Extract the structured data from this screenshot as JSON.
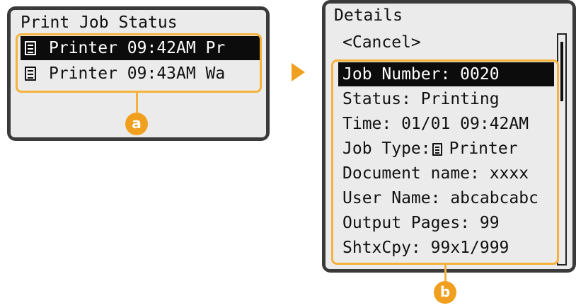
{
  "left_screen": {
    "title": "Print Job Status",
    "jobs": [
      {
        "icon": "document-icon",
        "text": "Printer 09:42AM Pr"
      },
      {
        "icon": "document-icon",
        "text": "Printer 09:43AM Wa"
      }
    ]
  },
  "right_screen": {
    "title": "Details",
    "cancel": "<Cancel>",
    "items": [
      "Job Number: 0020",
      "Status: Printing",
      "Time: 01/01 09:42AM",
      "Document name: xxxx",
      "User Name: abcabcabc",
      "Output Pages: 99",
      "ShtxCpy: 99x1/999"
    ],
    "job_type": {
      "label": "Job Type:",
      "icon": "document-icon",
      "value": "Printer"
    }
  },
  "callouts": {
    "a": "a",
    "b": "b"
  },
  "colors": {
    "accent": "#f5b23c",
    "badge": "#f0a01e",
    "panel": "#3a3a3a",
    "screen": "#ebebeb"
  }
}
